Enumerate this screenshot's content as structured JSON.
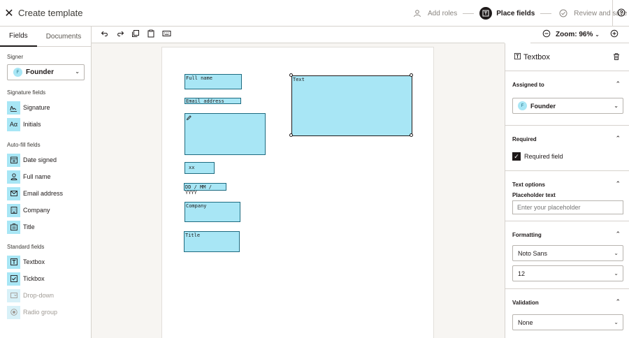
{
  "header": {
    "close_icon": "close-icon",
    "title": "Create template",
    "steps": [
      {
        "label": "Add roles",
        "icon": "user-icon",
        "active": false
      },
      {
        "label": "Place fields",
        "icon": "fields-icon",
        "active": true
      },
      {
        "label": "Review and save",
        "icon": "check-circle-icon",
        "active": false
      }
    ],
    "help_icon": "help-icon"
  },
  "sidebar": {
    "tabs": [
      {
        "label": "Fields",
        "active": true
      },
      {
        "label": "Documents",
        "active": false
      }
    ],
    "signer_label": "Signer",
    "signer_initial": "F",
    "signer_value": "Founder",
    "sections": [
      {
        "title": "Signature fields",
        "items": [
          {
            "label": "Signature",
            "icon": "signature-icon"
          },
          {
            "label": "Initials",
            "icon": "initials-icon"
          }
        ]
      },
      {
        "title": "Auto-fill fields",
        "items": [
          {
            "label": "Date signed",
            "icon": "calendar-icon"
          },
          {
            "label": "Full name",
            "icon": "person-icon"
          },
          {
            "label": "Email address",
            "icon": "mail-icon"
          },
          {
            "label": "Company",
            "icon": "building-icon"
          },
          {
            "label": "Title",
            "icon": "badge-icon"
          }
        ]
      },
      {
        "title": "Standard fields",
        "items": [
          {
            "label": "Textbox",
            "icon": "textbox-icon"
          },
          {
            "label": "Tickbox",
            "icon": "checkbox-icon"
          },
          {
            "label": "Drop-down",
            "icon": "dropdown-icon",
            "disabled": true
          },
          {
            "label": "Radio group",
            "icon": "radio-icon",
            "disabled": true
          }
        ]
      }
    ]
  },
  "toolbar": {
    "undo_icon": "undo-icon",
    "redo_icon": "redo-icon",
    "copy_icon": "copy-icon",
    "paste_icon": "paste-icon",
    "keyboard_icon": "keyboard-icon",
    "zoom_out_icon": "zoom-out-icon",
    "zoom_label": "Zoom: 96%",
    "zoom_in_icon": "zoom-in-icon"
  },
  "document": {
    "fields": [
      {
        "id": "full-name",
        "label": "Full name"
      },
      {
        "id": "email",
        "label": "Email address"
      },
      {
        "id": "signature",
        "label": ""
      },
      {
        "id": "initials",
        "label": "xx"
      },
      {
        "id": "date",
        "label": "DD / MM / YYYY"
      },
      {
        "id": "company",
        "label": "Company"
      },
      {
        "id": "title",
        "label": "Title"
      },
      {
        "id": "textbox",
        "label": "Text"
      }
    ]
  },
  "panel": {
    "title": "Textbox",
    "assigned_to": {
      "title": "Assigned to",
      "initial": "F",
      "value": "Founder"
    },
    "required": {
      "title": "Required",
      "checkbox_label": "Required field",
      "checked": true
    },
    "text_options": {
      "title": "Text options",
      "placeholder_label": "Placeholder text",
      "placeholder_input": "Enter your placeholder"
    },
    "formatting": {
      "title": "Formatting",
      "font": "Noto Sans",
      "size": "12"
    },
    "validation": {
      "title": "Validation",
      "value": "None"
    }
  }
}
